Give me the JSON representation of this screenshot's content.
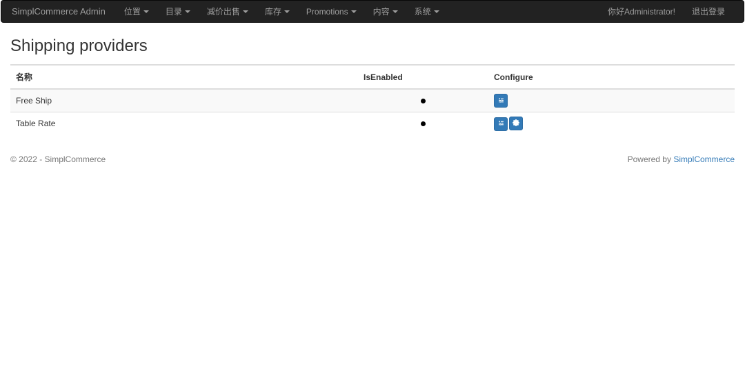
{
  "navbar": {
    "brand": "SimplCommerce Admin",
    "menu": [
      {
        "label": "位置"
      },
      {
        "label": "目录"
      },
      {
        "label": "减价出售"
      },
      {
        "label": "库存"
      },
      {
        "label": "Promotions"
      },
      {
        "label": "内容"
      },
      {
        "label": "系统"
      }
    ],
    "greeting": "你好Administrator!",
    "logout": "退出登录"
  },
  "page": {
    "title": "Shipping providers"
  },
  "table": {
    "headers": {
      "name": "名称",
      "enabled": "IsEnabled",
      "configure": "Configure"
    },
    "rows": [
      {
        "name": "Free Ship",
        "enabled": true,
        "hasConfig": false
      },
      {
        "name": "Table Rate",
        "enabled": true,
        "hasConfig": true
      }
    ]
  },
  "footer": {
    "copyright": "© 2022 - SimplCommerce",
    "poweredBy": "Powered by",
    "poweredByLink": "SimplCommerce"
  }
}
